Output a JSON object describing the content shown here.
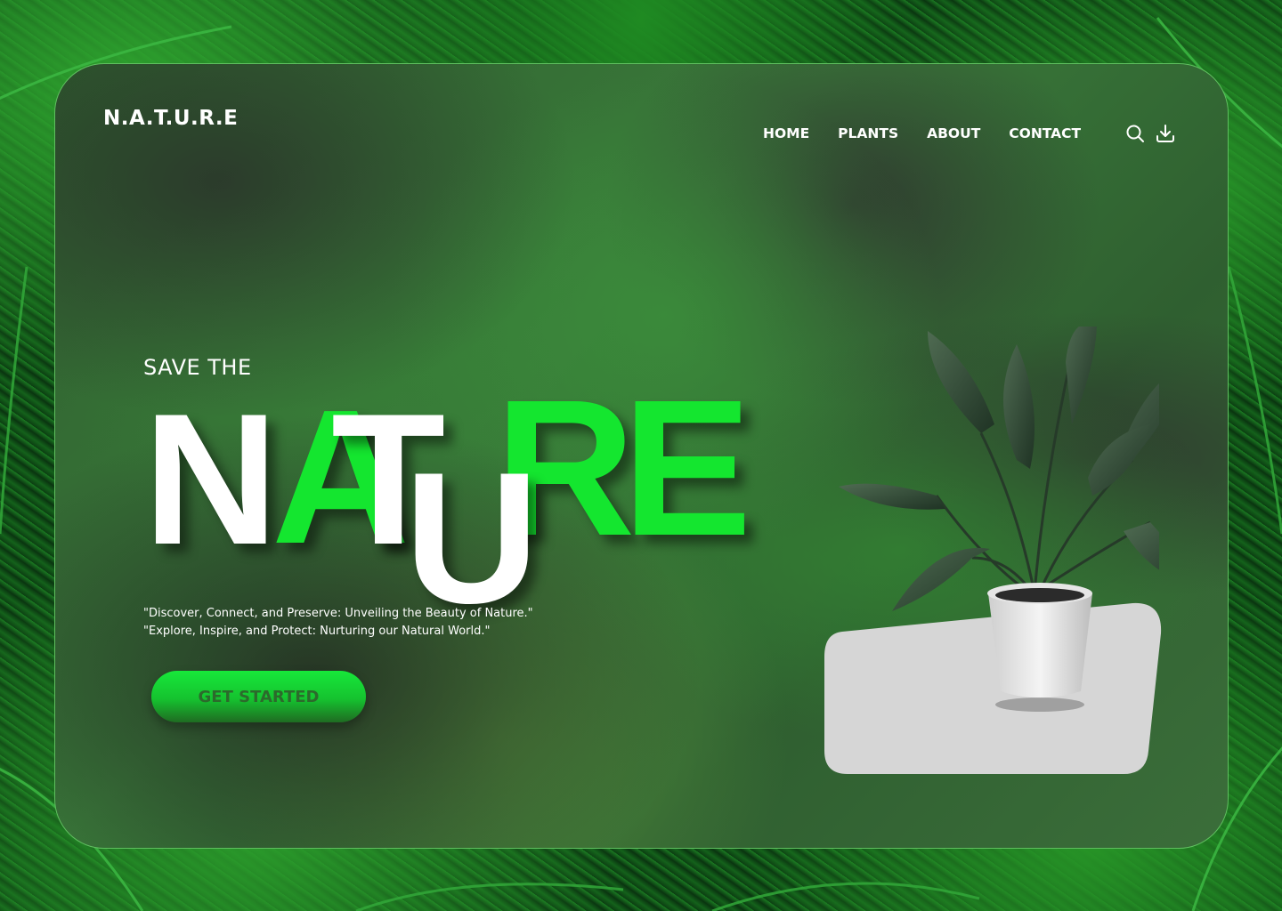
{
  "brand": {
    "logo": "N.A.T.U.R.E"
  },
  "nav": {
    "items": [
      "HOME",
      "PLANTS",
      "ABOUT",
      "CONTACT"
    ]
  },
  "header_icons": [
    "search-icon",
    "download-icon"
  ],
  "hero": {
    "eyebrow": "SAVE THE",
    "letters": {
      "n": "N",
      "a": "A",
      "t": "T",
      "u": "U",
      "r": "R",
      "e": "E"
    },
    "tagline_1": "\"Discover, Connect, and Preserve: Unveiling the Beauty of Nature.\"",
    "tagline_2": "\"Explore, Inspire, and Protect: Nurturing our Natural World.\"",
    "cta_label": "GET STARTED"
  },
  "colors": {
    "accent": "#14e62f",
    "white": "#ffffff",
    "pedestal": "#d6d6d6",
    "border": "#5fbf5f"
  }
}
